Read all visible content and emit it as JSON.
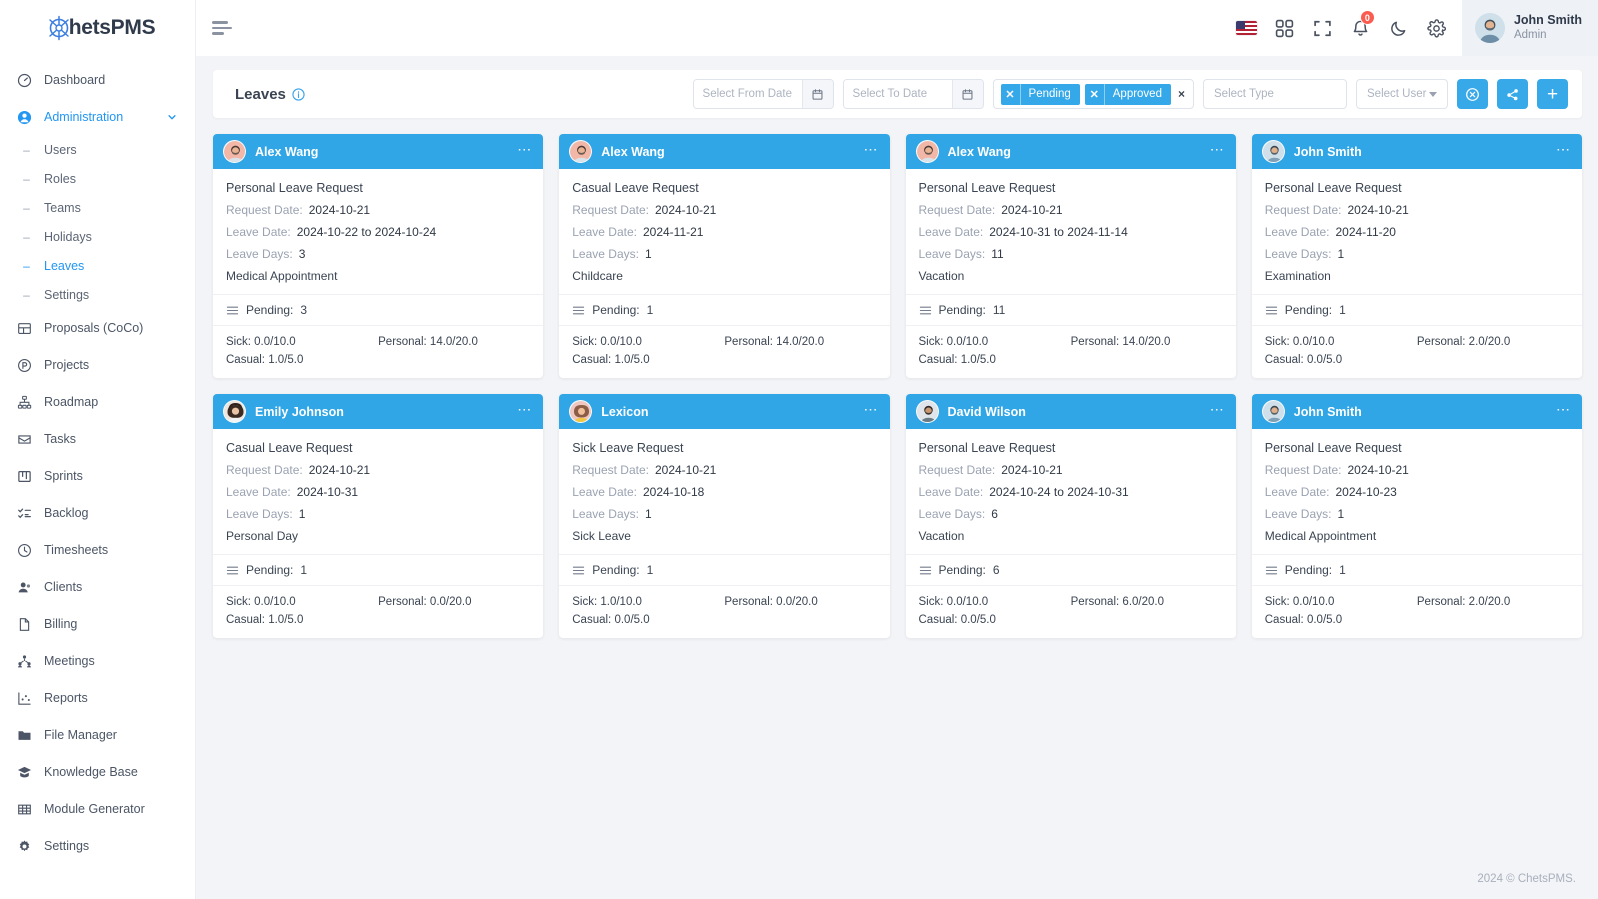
{
  "brand": {
    "name_prefix": "C",
    "name": "hetsPMS"
  },
  "sidebar": {
    "items": [
      {
        "label": "Dashboard",
        "icon": "speedometer-icon",
        "type": "item"
      },
      {
        "label": "Administration",
        "icon": "user-circle-icon",
        "type": "group",
        "active": true
      },
      {
        "label": "Users",
        "type": "sub"
      },
      {
        "label": "Roles",
        "type": "sub"
      },
      {
        "label": "Teams",
        "type": "sub"
      },
      {
        "label": "Holidays",
        "type": "sub"
      },
      {
        "label": "Leaves",
        "type": "sub",
        "active": true
      },
      {
        "label": "Settings",
        "type": "sub"
      },
      {
        "label": "Proposals (CoCo)",
        "icon": "layout-icon",
        "type": "item"
      },
      {
        "label": "Projects",
        "icon": "projects-icon",
        "type": "item"
      },
      {
        "label": "Roadmap",
        "icon": "roadmap-icon",
        "type": "item"
      },
      {
        "label": "Tasks",
        "icon": "tasks-icon",
        "type": "item"
      },
      {
        "label": "Sprints",
        "icon": "sprints-icon",
        "type": "item"
      },
      {
        "label": "Backlog",
        "icon": "backlog-icon",
        "type": "item"
      },
      {
        "label": "Timesheets",
        "icon": "clock-icon",
        "type": "item"
      },
      {
        "label": "Clients",
        "icon": "clients-icon",
        "type": "item"
      },
      {
        "label": "Billing",
        "icon": "document-icon",
        "type": "item"
      },
      {
        "label": "Meetings",
        "icon": "meetings-icon",
        "type": "item"
      },
      {
        "label": "Reports",
        "icon": "reports-icon",
        "type": "item"
      },
      {
        "label": "File Manager",
        "icon": "folder-icon",
        "type": "item"
      },
      {
        "label": "Knowledge Base",
        "icon": "knowledge-icon",
        "type": "item"
      },
      {
        "label": "Module Generator",
        "icon": "grid-icon",
        "type": "item"
      },
      {
        "label": "Settings",
        "icon": "gear-icon",
        "type": "item"
      }
    ]
  },
  "topbar": {
    "menu_icon": "hamburger-icon",
    "icons": [
      {
        "name": "language-flag-icon",
        "label": "US"
      },
      {
        "name": "apps-grid-icon"
      },
      {
        "name": "fullscreen-icon"
      },
      {
        "name": "bell-icon",
        "badge": "0"
      },
      {
        "name": "dark-mode-moon-icon"
      },
      {
        "name": "gear-icon"
      }
    ],
    "profile": {
      "name": "John Smith",
      "role": "Admin"
    }
  },
  "toolbar": {
    "title": "Leaves",
    "info_icon": "info-circle-icon",
    "from_date_placeholder": "Select From Date",
    "from_date_value": "",
    "to_date_placeholder": "Select To Date",
    "to_date_value": "",
    "status_tags": [
      "Pending",
      "Approved"
    ],
    "tags_clear_label": "×",
    "type_placeholder": "Select Type",
    "user_placeholder": "Select User",
    "actions": [
      {
        "name": "reset-filters-button",
        "icon": "circle-x-icon"
      },
      {
        "name": "share-button",
        "icon": "share-nodes-icon"
      },
      {
        "name": "add-leave-button",
        "icon": "plus-icon",
        "label": "+"
      }
    ]
  },
  "labels": {
    "request_date": "Request Date:",
    "leave_date": "Leave Date:",
    "leave_days": "Leave Days:",
    "pending_prefix": "Pending:",
    "sick_prefix": "Sick:",
    "personal_prefix": "Personal:",
    "casual_prefix": "Casual:"
  },
  "cards": [
    {
      "user": "Alex Wang",
      "avatar_tone": "#f3b7a8",
      "title": "Personal Leave Request",
      "request_date": "2024-10-21",
      "leave_date": "2024-10-22 to 2024-10-24",
      "leave_days": "3",
      "reason": "Medical Appointment",
      "pending": "3",
      "sick": "0.0/10.0",
      "personal": "14.0/20.0",
      "casual": "1.0/5.0"
    },
    {
      "user": "Alex Wang",
      "avatar_tone": "#f3b7a8",
      "title": "Casual Leave Request",
      "request_date": "2024-10-21",
      "leave_date": "2024-11-21",
      "leave_days": "1",
      "reason": "Childcare",
      "pending": "1",
      "sick": "0.0/10.0",
      "personal": "14.0/20.0",
      "casual": "1.0/5.0"
    },
    {
      "user": "Alex Wang",
      "avatar_tone": "#f3b7a8",
      "title": "Personal Leave Request",
      "request_date": "2024-10-21",
      "leave_date": "2024-10-31 to 2024-11-14",
      "leave_days": "11",
      "reason": "Vacation",
      "pending": "11",
      "sick": "0.0/10.0",
      "personal": "14.0/20.0",
      "casual": "1.0/5.0"
    },
    {
      "user": "John Smith",
      "avatar_tone": "#cfe0ea",
      "title": "Personal Leave Request",
      "request_date": "2024-10-21",
      "leave_date": "2024-11-20",
      "leave_days": "1",
      "reason": "Examination",
      "pending": "1",
      "sick": "0.0/10.0",
      "personal": "2.0/20.0",
      "casual": "0.0/5.0"
    },
    {
      "user": "Emily Johnson",
      "avatar_tone": "#e3d3c6",
      "title": "Casual Leave Request",
      "request_date": "2024-10-21",
      "leave_date": "2024-10-31",
      "leave_days": "1",
      "reason": "Personal Day",
      "pending": "1",
      "sick": "0.0/10.0",
      "personal": "0.0/20.0",
      "casual": "1.0/5.0"
    },
    {
      "user": "Lexicon",
      "avatar_tone": "#f0c6c0",
      "title": "Sick Leave Request",
      "request_date": "2024-10-21",
      "leave_date": "2024-10-18",
      "leave_days": "1",
      "reason": "Sick Leave",
      "pending": "1",
      "sick": "1.0/10.0",
      "personal": "0.0/20.0",
      "casual": "0.0/5.0"
    },
    {
      "user": "David Wilson",
      "avatar_tone": "#bcc8d2",
      "title": "Personal Leave Request",
      "request_date": "2024-10-21",
      "leave_date": "2024-10-24 to 2024-10-31",
      "leave_days": "6",
      "reason": "Vacation",
      "pending": "6",
      "sick": "0.0/10.0",
      "personal": "6.0/20.0",
      "casual": "0.0/5.0"
    },
    {
      "user": "John Smith",
      "avatar_tone": "#cfe0ea",
      "title": "Personal Leave Request",
      "request_date": "2024-10-21",
      "leave_date": "2024-10-23",
      "leave_days": "1",
      "reason": "Medical Appointment",
      "pending": "1",
      "sick": "0.0/10.0",
      "personal": "2.0/20.0",
      "casual": "0.0/5.0"
    }
  ],
  "footer": {
    "text": "2024 © ChetsPMS."
  },
  "colors": {
    "accent": "#30a6e6",
    "brand_blue": "#3c7fe0",
    "badge_red": "#fa5c4f",
    "sidebar_bg": "#ffffff",
    "page_bg": "#f3f4f7"
  }
}
